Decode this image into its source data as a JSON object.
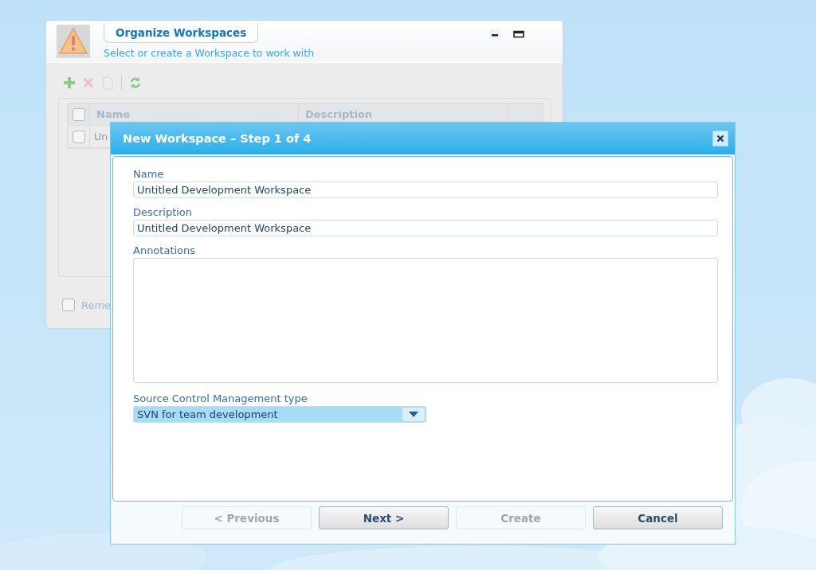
{
  "background_window": {
    "title": "Organize Workspaces",
    "subtitle": "Select or create a Workspace to work with",
    "toolbar": [
      {
        "kind": "add",
        "disabled": false
      },
      {
        "kind": "delete",
        "disabled": true
      },
      {
        "kind": "document",
        "disabled": true
      },
      {
        "kind": "refresh",
        "disabled": false
      }
    ],
    "table": {
      "columns": [
        "Name",
        "Description"
      ],
      "header_checked": false,
      "rows": [
        {
          "name": "Un",
          "checked": false
        }
      ]
    },
    "remember": {
      "label": "Reme",
      "checked": false
    }
  },
  "dialog": {
    "title": "New Workspace – Step 1 of 4",
    "fields": [
      {
        "kind": "text",
        "label": "Name",
        "value": "Untitled Development Workspace"
      },
      {
        "kind": "text",
        "label": "Description",
        "value": "Untitled Development Workspace"
      },
      {
        "kind": "textarea",
        "label": "Annotations"
      },
      {
        "kind": "select",
        "label": "Source Control Management type",
        "value": "SVN for team development"
      }
    ],
    "buttons": [
      {
        "label": "< Previous",
        "disabled": true
      },
      {
        "label": "Next >",
        "disabled": false
      },
      {
        "label": "Create",
        "disabled": true
      },
      {
        "label": "Cancel",
        "disabled": false
      }
    ]
  }
}
